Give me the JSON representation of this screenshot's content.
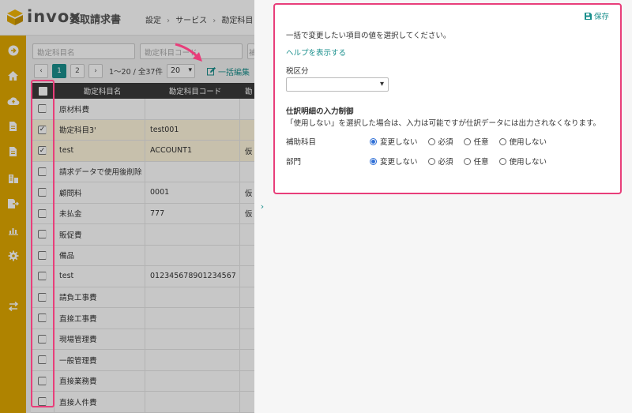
{
  "header": {
    "logo_text": "invox",
    "logo_sub": "受取請求書",
    "breadcrumb": [
      "設定",
      "サービス",
      "勘定科目・補"
    ]
  },
  "sidebar": {
    "icons": [
      "arrow-right-circle-icon",
      "home-icon",
      "cloud-upload-icon",
      "document-icon",
      "document-icon",
      "building-icon",
      "export-icon",
      "chart-icon",
      "gear-icon",
      "swap-icon"
    ]
  },
  "filters": {
    "account_name_placeholder": "勘定科目名",
    "account_code_placeholder": "勘定科目コード",
    "third_placeholder": "補"
  },
  "pager": {
    "prev": "‹",
    "pages": [
      "1",
      "2"
    ],
    "next": "›",
    "info": "1〜20 / 全37件",
    "page_size": "20",
    "bulk_edit_label": "一括編集"
  },
  "table": {
    "headers": {
      "name": "勘定科目名",
      "code": "勘定科目コード",
      "extra": "勘"
    },
    "rows": [
      {
        "name": "原材料費",
        "code": "",
        "extra": "",
        "checked": false
      },
      {
        "name": "勘定科目3'",
        "code": "test001",
        "extra": "",
        "checked": true
      },
      {
        "name": "test",
        "code": "ACCOUNT1",
        "extra": "仮",
        "checked": true
      },
      {
        "name": "請求データで使用後削除",
        "code": "",
        "extra": "",
        "checked": false
      },
      {
        "name": "顧問料",
        "code": "0001",
        "extra": "仮",
        "checked": false
      },
      {
        "name": "未払金",
        "code": "777",
        "extra": "仮",
        "checked": false
      },
      {
        "name": "販促費",
        "code": "",
        "extra": "",
        "checked": false
      },
      {
        "name": "備品",
        "code": "",
        "extra": "",
        "checked": false
      },
      {
        "name": "test",
        "code": "012345678901234567",
        "extra": "",
        "checked": false
      },
      {
        "name": "請負工事費",
        "code": "",
        "extra": "",
        "checked": false
      },
      {
        "name": "直接工事費",
        "code": "",
        "extra": "",
        "checked": false
      },
      {
        "name": "現場管理費",
        "code": "",
        "extra": "",
        "checked": false
      },
      {
        "name": "一般管理費",
        "code": "",
        "extra": "",
        "checked": false
      },
      {
        "name": "直接業務費",
        "code": "",
        "extra": "",
        "checked": false
      },
      {
        "name": "直接人件費",
        "code": "",
        "extra": "",
        "checked": false
      }
    ]
  },
  "panel": {
    "save_label": "保存",
    "instruction": "一括で変更したい項目の値を選択してください。",
    "help_link": "ヘルプを表示する",
    "tax_label": "税区分",
    "tax_value": "",
    "section_title": "仕訳明細の入力制御",
    "section_note": "「使用しない」を選択した場合は、入力は可能ですが仕訳データには出力されなくなります。",
    "rows": [
      {
        "label": "補助科目",
        "options": [
          "変更しない",
          "必須",
          "任意",
          "使用しない"
        ],
        "selected": 0
      },
      {
        "label": "部門",
        "options": [
          "変更しない",
          "必須",
          "任意",
          "使用しない"
        ],
        "selected": 0
      }
    ]
  },
  "colors": {
    "accent": "#1a8f8c",
    "sidebar": "#e0a800",
    "highlight": "#e83e7a"
  }
}
